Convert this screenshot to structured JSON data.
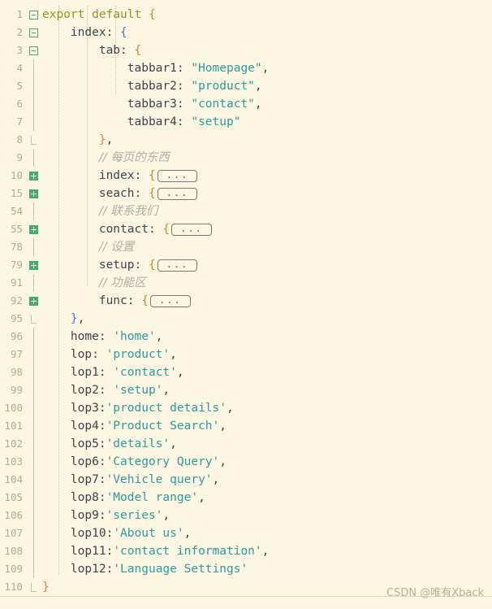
{
  "editor": {
    "background": "#fdf6e3",
    "gutter_color": "#b5ab8e",
    "string_color": "#2a9d9d",
    "keyword_color": "#9a9122",
    "comment_color": "#adb0a8",
    "fold_marker_color": "#45ab72",
    "fold_placeholder_label": "..."
  },
  "watermark": {
    "text": "CSDN @唯有Xback"
  },
  "lines": [
    {
      "num": "1",
      "fold": "minus",
      "indent": 0,
      "tokens": [
        {
          "t": "kw",
          "v": "export default "
        },
        {
          "t": "brace",
          "v": "{"
        }
      ]
    },
    {
      "num": "2",
      "fold": "minus",
      "indent": 1,
      "tokens": [
        {
          "t": "prop",
          "v": "index"
        },
        {
          "t": "punct",
          "v": ": "
        },
        {
          "t": "brace2",
          "v": "{"
        }
      ]
    },
    {
      "num": "3",
      "fold": "minus",
      "indent": 2,
      "tokens": [
        {
          "t": "prop",
          "v": "tab"
        },
        {
          "t": "punct",
          "v": ": "
        },
        {
          "t": "brace",
          "v": "{"
        }
      ]
    },
    {
      "num": "4",
      "fold": "line",
      "indent": 3,
      "tokens": [
        {
          "t": "prop",
          "v": "tabbar1"
        },
        {
          "t": "punct",
          "v": ": "
        },
        {
          "t": "str",
          "v": "\"Homepage\""
        },
        {
          "t": "punct",
          "v": ","
        }
      ]
    },
    {
      "num": "5",
      "fold": "line",
      "indent": 3,
      "tokens": [
        {
          "t": "prop",
          "v": "tabbar2"
        },
        {
          "t": "punct",
          "v": ": "
        },
        {
          "t": "str",
          "v": "\"product\""
        },
        {
          "t": "punct",
          "v": ","
        }
      ]
    },
    {
      "num": "6",
      "fold": "line",
      "indent": 3,
      "tokens": [
        {
          "t": "prop",
          "v": "tabbar3"
        },
        {
          "t": "punct",
          "v": ": "
        },
        {
          "t": "str",
          "v": "\"contact\""
        },
        {
          "t": "punct",
          "v": ","
        }
      ]
    },
    {
      "num": "7",
      "fold": "line",
      "indent": 3,
      "tokens": [
        {
          "t": "prop",
          "v": "tabbar4"
        },
        {
          "t": "punct",
          "v": ": "
        },
        {
          "t": "str",
          "v": "\"setup\""
        }
      ]
    },
    {
      "num": "8",
      "fold": "end",
      "indent": 2,
      "tokens": [
        {
          "t": "brace",
          "v": "}"
        },
        {
          "t": "punct",
          "v": ","
        }
      ]
    },
    {
      "num": "9",
      "fold": "line",
      "indent": 2,
      "tokens": [
        {
          "t": "comment",
          "v": "// 每页的东西"
        }
      ]
    },
    {
      "num": "10",
      "fold": "plus",
      "indent": 2,
      "tokens": [
        {
          "t": "prop",
          "v": "index"
        },
        {
          "t": "punct",
          "v": ": "
        },
        {
          "t": "brace",
          "v": "{"
        },
        {
          "t": "foldbox",
          "v": "..."
        }
      ]
    },
    {
      "num": "15",
      "fold": "plus",
      "indent": 2,
      "tokens": [
        {
          "t": "prop",
          "v": "seach"
        },
        {
          "t": "punct",
          "v": ": "
        },
        {
          "t": "brace",
          "v": "{"
        },
        {
          "t": "foldbox",
          "v": "..."
        }
      ]
    },
    {
      "num": "54",
      "fold": "line",
      "indent": 2,
      "tokens": [
        {
          "t": "comment",
          "v": "// 联系我们"
        }
      ]
    },
    {
      "num": "55",
      "fold": "plus",
      "indent": 2,
      "tokens": [
        {
          "t": "prop",
          "v": "contact"
        },
        {
          "t": "punct",
          "v": ": "
        },
        {
          "t": "brace",
          "v": "{"
        },
        {
          "t": "foldbox",
          "v": "..."
        }
      ]
    },
    {
      "num": "78",
      "fold": "line",
      "indent": 2,
      "tokens": [
        {
          "t": "comment",
          "v": "// 设置"
        }
      ]
    },
    {
      "num": "79",
      "fold": "plus",
      "indent": 2,
      "tokens": [
        {
          "t": "prop",
          "v": "setup"
        },
        {
          "t": "punct",
          "v": ": "
        },
        {
          "t": "brace",
          "v": "{"
        },
        {
          "t": "foldbox",
          "v": "..."
        }
      ]
    },
    {
      "num": "91",
      "fold": "line",
      "indent": 2,
      "tokens": [
        {
          "t": "comment",
          "v": "// 功能区"
        }
      ]
    },
    {
      "num": "92",
      "fold": "plus",
      "indent": 2,
      "tokens": [
        {
          "t": "prop",
          "v": "func"
        },
        {
          "t": "punct",
          "v": ": "
        },
        {
          "t": "brace",
          "v": "{"
        },
        {
          "t": "foldbox",
          "v": "..."
        }
      ]
    },
    {
      "num": "95",
      "fold": "end",
      "indent": 1,
      "tokens": [
        {
          "t": "brace2",
          "v": "}"
        },
        {
          "t": "punct",
          "v": ","
        }
      ]
    },
    {
      "num": "96",
      "fold": "line",
      "indent": 1,
      "tokens": [
        {
          "t": "prop",
          "v": "home"
        },
        {
          "t": "punct",
          "v": ": "
        },
        {
          "t": "str",
          "v": "'home'"
        },
        {
          "t": "punct",
          "v": ","
        }
      ]
    },
    {
      "num": "97",
      "fold": "line",
      "indent": 1,
      "tokens": [
        {
          "t": "prop",
          "v": "lop"
        },
        {
          "t": "punct",
          "v": ": "
        },
        {
          "t": "str",
          "v": "'product'"
        },
        {
          "t": "punct",
          "v": ","
        }
      ]
    },
    {
      "num": "98",
      "fold": "line",
      "indent": 1,
      "tokens": [
        {
          "t": "prop",
          "v": "lop1"
        },
        {
          "t": "punct",
          "v": ": "
        },
        {
          "t": "str",
          "v": "'contact'"
        },
        {
          "t": "punct",
          "v": ","
        }
      ]
    },
    {
      "num": "99",
      "fold": "line",
      "indent": 1,
      "tokens": [
        {
          "t": "prop",
          "v": "lop2"
        },
        {
          "t": "punct",
          "v": ": "
        },
        {
          "t": "str",
          "v": "'setup'"
        },
        {
          "t": "punct",
          "v": ","
        }
      ]
    },
    {
      "num": "100",
      "fold": "line",
      "indent": 1,
      "tokens": [
        {
          "t": "prop",
          "v": "lop3"
        },
        {
          "t": "punct",
          "v": ":"
        },
        {
          "t": "str",
          "v": "'product details'"
        },
        {
          "t": "punct",
          "v": ","
        }
      ]
    },
    {
      "num": "101",
      "fold": "line",
      "indent": 1,
      "tokens": [
        {
          "t": "prop",
          "v": "lop4"
        },
        {
          "t": "punct",
          "v": ":"
        },
        {
          "t": "str",
          "v": "'Product Search'"
        },
        {
          "t": "punct",
          "v": ","
        }
      ]
    },
    {
      "num": "102",
      "fold": "line",
      "indent": 1,
      "tokens": [
        {
          "t": "prop",
          "v": "lop5"
        },
        {
          "t": "punct",
          "v": ":"
        },
        {
          "t": "str",
          "v": "'details'"
        },
        {
          "t": "punct",
          "v": ","
        }
      ]
    },
    {
      "num": "103",
      "fold": "line",
      "indent": 1,
      "tokens": [
        {
          "t": "prop",
          "v": "lop6"
        },
        {
          "t": "punct",
          "v": ":"
        },
        {
          "t": "str",
          "v": "'Category Query'"
        },
        {
          "t": "punct",
          "v": ","
        }
      ]
    },
    {
      "num": "104",
      "fold": "line",
      "indent": 1,
      "tokens": [
        {
          "t": "prop",
          "v": "lop7"
        },
        {
          "t": "punct",
          "v": ":"
        },
        {
          "t": "str",
          "v": "'Vehicle query'"
        },
        {
          "t": "punct",
          "v": ","
        }
      ]
    },
    {
      "num": "105",
      "fold": "line",
      "indent": 1,
      "tokens": [
        {
          "t": "prop",
          "v": "lop8"
        },
        {
          "t": "punct",
          "v": ":"
        },
        {
          "t": "str",
          "v": "'Model range'"
        },
        {
          "t": "punct",
          "v": ","
        }
      ]
    },
    {
      "num": "106",
      "fold": "line",
      "indent": 1,
      "tokens": [
        {
          "t": "prop",
          "v": "lop9"
        },
        {
          "t": "punct",
          "v": ":"
        },
        {
          "t": "str",
          "v": "'series'"
        },
        {
          "t": "punct",
          "v": ","
        }
      ]
    },
    {
      "num": "107",
      "fold": "line",
      "indent": 1,
      "tokens": [
        {
          "t": "prop",
          "v": "lop10"
        },
        {
          "t": "punct",
          "v": ":"
        },
        {
          "t": "str",
          "v": "'About us'"
        },
        {
          "t": "punct",
          "v": ","
        }
      ]
    },
    {
      "num": "108",
      "fold": "line",
      "indent": 1,
      "tokens": [
        {
          "t": "prop",
          "v": "lop11"
        },
        {
          "t": "punct",
          "v": ":"
        },
        {
          "t": "str",
          "v": "'contact information'"
        },
        {
          "t": "punct",
          "v": ","
        }
      ]
    },
    {
      "num": "109",
      "fold": "line",
      "indent": 1,
      "tokens": [
        {
          "t": "prop",
          "v": "lop12"
        },
        {
          "t": "punct",
          "v": ":"
        },
        {
          "t": "str",
          "v": "'Language Settings'"
        }
      ]
    },
    {
      "num": "110",
      "fold": "end",
      "indent": 0,
      "tokens": [
        {
          "t": "brace",
          "v": "}"
        }
      ]
    }
  ]
}
